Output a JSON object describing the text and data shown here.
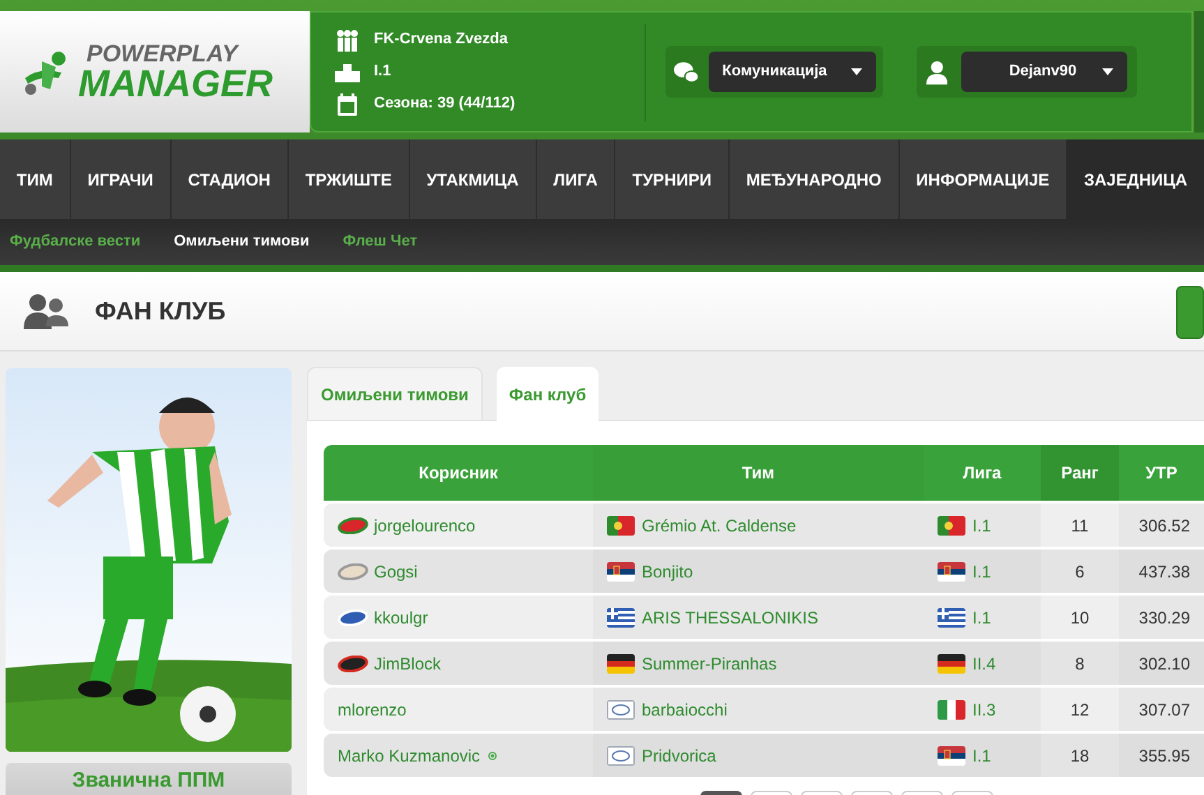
{
  "header": {
    "logo_top": "POWERPLAY",
    "logo_bottom": "MANAGER",
    "team": "FK-Crvena Zvezda",
    "league": "I.1",
    "season": "Сезона: 39 (44/112)",
    "communication": "Комуникација",
    "user": "Dejanv90"
  },
  "nav": [
    {
      "label": "ТИМ",
      "selected": false
    },
    {
      "label": "ИГРАЧИ",
      "selected": false
    },
    {
      "label": "СТАДИОН",
      "selected": false
    },
    {
      "label": "ТРЖИШТЕ",
      "selected": false
    },
    {
      "label": "УТАКМИЦА",
      "selected": false
    },
    {
      "label": "ЛИГА",
      "selected": false
    },
    {
      "label": "ТУРНИРИ",
      "selected": false
    },
    {
      "label": "МЕЂУНАРОДНО",
      "selected": false
    },
    {
      "label": "ИНФОРМАЦИЈЕ",
      "selected": false
    },
    {
      "label": "ЗАЈЕДНИЦА",
      "selected": true
    }
  ],
  "subnav": [
    {
      "label": "Фудбалске вести",
      "selected": false
    },
    {
      "label": "Омиљени тимови",
      "selected": true
    },
    {
      "label": "Флеш Чет",
      "selected": false
    }
  ],
  "page_title": "ФАН КЛУБ",
  "side_button": "Званична ППМ",
  "tabs": [
    {
      "label": "Омиљени тимови",
      "selected": false
    },
    {
      "label": "Фан клуб",
      "selected": true
    }
  ],
  "table": {
    "columns": [
      "Корисник",
      "Тим",
      "Лига",
      "Ранг",
      "УТР"
    ],
    "rows": [
      {
        "user": "jorgelourenco",
        "badge": {
          "kind": "portugal"
        },
        "online": false,
        "team": "Grémio At. Caldense",
        "team_flag": {
          "kind": "portugal"
        },
        "league_flag": {
          "kind": "portugal"
        },
        "league": "I.1",
        "rank": "11",
        "utr": "306.52"
      },
      {
        "user": "Gogsi",
        "badge": {
          "kind": "plain"
        },
        "online": false,
        "team": "Bonjito",
        "team_flag": {
          "kind": "serbia"
        },
        "league_flag": {
          "kind": "serbia"
        },
        "league": "I.1",
        "rank": "6",
        "utr": "437.38"
      },
      {
        "user": "kkoulgr",
        "badge": {
          "kind": "greece"
        },
        "online": false,
        "team": "ARIS THESSALONIKIS",
        "team_flag": {
          "kind": "greece"
        },
        "league_flag": {
          "kind": "greece"
        },
        "league": "I.1",
        "rank": "10",
        "utr": "330.29"
      },
      {
        "user": "JimBlock",
        "badge": {
          "kind": "germany"
        },
        "online": false,
        "team": "Summer-Piranhas",
        "team_flag": {
          "kind": "germany"
        },
        "league_flag": {
          "kind": "germany"
        },
        "league": "II.4",
        "rank": "8",
        "utr": "302.10"
      },
      {
        "user": "mlorenzo",
        "online": false,
        "team": "barbaiocchi",
        "team_flag": {
          "kind": "generic"
        },
        "league_flag": {
          "kind": "italy"
        },
        "league": "II.3",
        "rank": "12",
        "utr": "307.07"
      },
      {
        "user": "Marko Kuzmanovic",
        "online": true,
        "team": "Pridvorica",
        "team_flag": {
          "kind": "generic"
        },
        "league_flag": {
          "kind": "serbia"
        },
        "league": "I.1",
        "rank": "18",
        "utr": "355.95"
      }
    ]
  },
  "pagination": [
    {
      "selected": true
    },
    {
      "selected": false
    },
    {
      "selected": false
    },
    {
      "selected": false
    },
    {
      "selected": false
    },
    {
      "selected": false
    }
  ]
}
